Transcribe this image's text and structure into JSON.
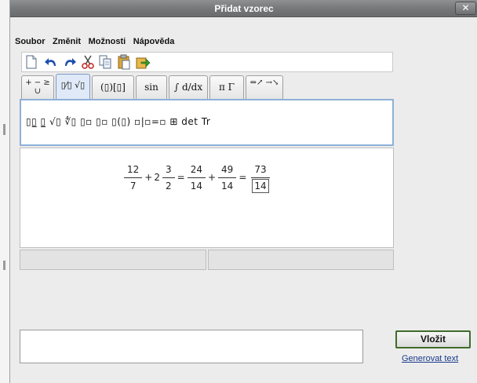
{
  "window": {
    "title": "Přidat vzorec",
    "close_label": "✕"
  },
  "menu": {
    "items": [
      "Soubor",
      "Změnit",
      "Možnosti",
      "Nápověda"
    ]
  },
  "toolbar": {
    "buttons": [
      "new-document-icon",
      "undo-icon",
      "redo-icon",
      "cut-icon",
      "copy-icon",
      "paste-icon",
      "export-icon"
    ]
  },
  "tabs": [
    {
      "label": "+ − ≥ ∪",
      "active": false
    },
    {
      "label": "▯⁄▯ √▯",
      "active": true
    },
    {
      "label": "(▯)[▯]",
      "active": false
    },
    {
      "label": "sin",
      "active": false
    },
    {
      "label": "∫ d/dx",
      "active": false
    },
    {
      "label": "π Γ",
      "active": false
    },
    {
      "label": "⇔↗ →↘",
      "active": false
    }
  ],
  "palette": {
    "text": "▯▯̲ ▯̲ √▯ ∜▯ ▯▫ ▯▫ ▯(▯) ▫|▫=▫ ⊞ det Tr"
  },
  "formula": {
    "t1_num": "12",
    "t1_den": "7",
    "plus1": "+",
    "whole": "2",
    "t2_num": "3",
    "t2_den": "2",
    "eq1": "=",
    "t3_num": "24",
    "t3_den": "14",
    "plus2": "+",
    "t4_num": "49",
    "t4_den": "14",
    "eq2": "=",
    "t5_num": "73",
    "t5_den": "14"
  },
  "actions": {
    "insert_label": "Vložit",
    "generate_label": "Generovat text"
  },
  "colors": {
    "titlebar": "#77787a",
    "active_tab": "#dfe9f7",
    "palette_border": "#8db0d8",
    "insert_border": "#3f6b2a"
  }
}
